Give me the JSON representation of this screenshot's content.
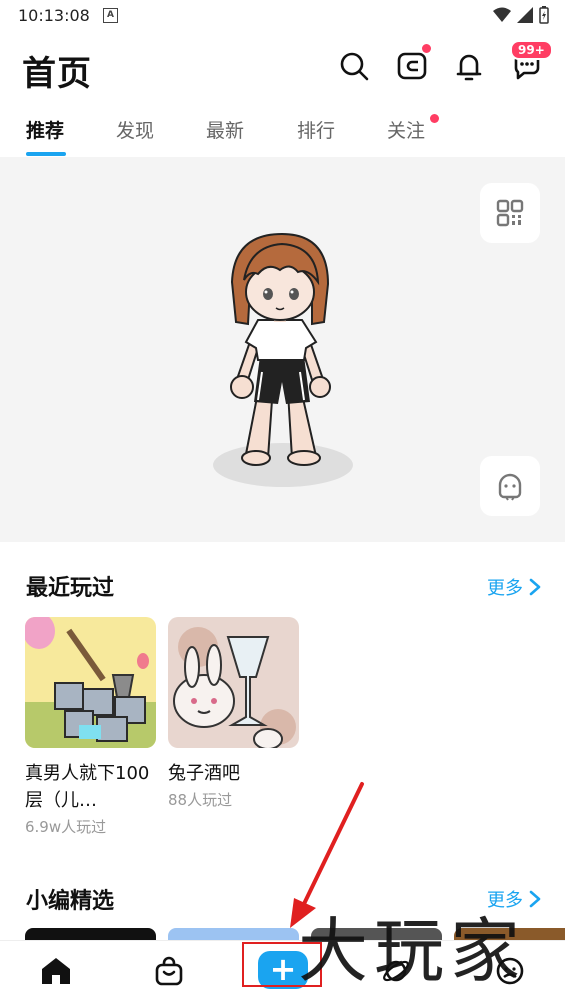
{
  "status_bar": {
    "time": "10:13:08",
    "notif_letter": "A"
  },
  "header": {
    "title": "首页",
    "message_badge": "99+"
  },
  "tabs": [
    {
      "label": "推荐",
      "active": true
    },
    {
      "label": "发现",
      "active": false
    },
    {
      "label": "最新",
      "active": false
    },
    {
      "label": "排行",
      "active": false
    },
    {
      "label": "关注",
      "active": false,
      "dot": true
    }
  ],
  "recent": {
    "title": "最近玩过",
    "more": "更多",
    "items": [
      {
        "name": "真男人就下100层（儿…",
        "players": "6.9w人玩过"
      },
      {
        "name": "兔子酒吧",
        "players": "88人玩过"
      }
    ]
  },
  "picks": {
    "title": "小编精选",
    "more": "更多"
  },
  "bottom_nav": {
    "items": [
      "home-icon",
      "shop-bag-icon",
      "create-plus-icon",
      "planet-icon",
      "profile-icon"
    ],
    "plus": "+"
  },
  "watermark": "大玩家",
  "colors": {
    "accent": "#1aa4f0",
    "badge": "#ff3d63",
    "annotation": "#e02020"
  }
}
